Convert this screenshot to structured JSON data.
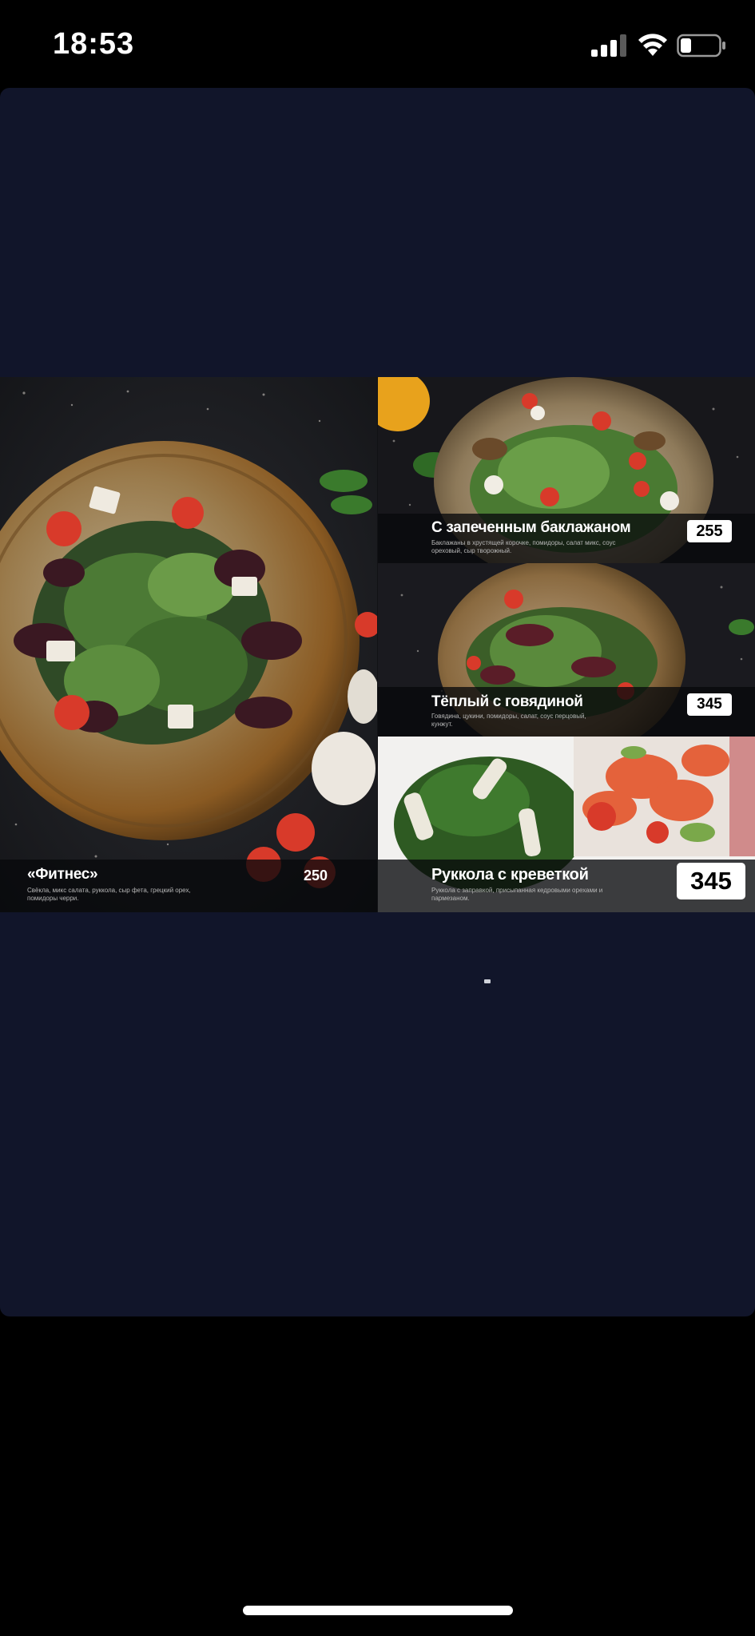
{
  "status_bar": {
    "time": "18:53",
    "signal_icon": "cellular-signal-icon",
    "wifi_icon": "wifi-icon",
    "battery_icon": "battery-low-icon"
  },
  "viewer": {
    "background_color": "#11152a",
    "content_type": "menu-image"
  },
  "menu": {
    "dishes": [
      {
        "name": "«Фитнес»",
        "description": "Свёкла, микс салата, руккола, сыр фета, грецкий орех, помидоры черри.",
        "price": "250",
        "price_style": "plain"
      },
      {
        "name": "С запеченным баклажаном",
        "description": "Баклажаны в хрустящей корочке, помидоры, салат микс, соус ореховый, сыр творожный.",
        "price": "255",
        "price_style": "tag"
      },
      {
        "name": "Тёплый с говядиной",
        "description": "Говядина, цукини, помидоры, салат, соус перцовый, кунжут.",
        "price": "345",
        "price_style": "tag"
      },
      {
        "name": "Руккола с креветкой",
        "description": "Руккола с заправкой, присыпанная кедровыми орехами и пармезаном.",
        "price": "345",
        "price_style": "tag"
      }
    ]
  },
  "colors": {
    "status_bar_bg": "#000000",
    "viewer_bg": "#11152a",
    "price_tag_bg": "#ffffff",
    "caption_bg": "#08090c"
  }
}
